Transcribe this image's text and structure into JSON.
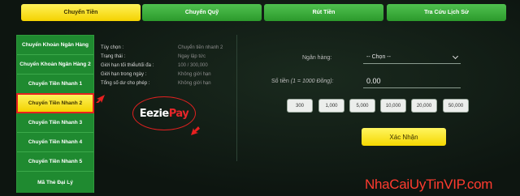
{
  "tabs": [
    {
      "label": "Chuyển Tiền",
      "active": true
    },
    {
      "label": "Chuyển Quỹ",
      "active": false
    },
    {
      "label": "Rút Tiền",
      "active": false
    },
    {
      "label": "Tra Cứu Lịch Sử",
      "active": false
    }
  ],
  "sidebar": {
    "items": [
      {
        "label": "Chuyển Khoản Ngân Hàng"
      },
      {
        "label": "Chuyển Khoản Ngân Hàng 2"
      },
      {
        "label": "Chuyển Tiền Nhanh 1"
      },
      {
        "label": "Chuyển Tiền Nhanh 2",
        "active": true
      },
      {
        "label": "Chuyển Tiền Nhanh 3"
      },
      {
        "label": "Chuyển Tiền Nhanh 4"
      },
      {
        "label": "Chuyển Tiền Nhanh 5"
      },
      {
        "label": "Mã Thẻ Đại Lý"
      }
    ]
  },
  "info": {
    "rows": [
      {
        "label": "Tùy chọn :",
        "value": "Chuyển tiền nhanh 2"
      },
      {
        "label": "Trạng thái :",
        "value": "Ngay lập tức"
      },
      {
        "label": "Giới hạn tối thiểu/tối đa :",
        "value": "100 / 300,000"
      },
      {
        "label": "Giới hạn trong ngày :",
        "value": "Không giới hạn"
      },
      {
        "label": "Tổng số dư cho phép :",
        "value": "Không giới hạn"
      }
    ]
  },
  "logo": {
    "part1": "Eezie",
    "part2": "Pay"
  },
  "form": {
    "bank_label": "Ngân hàng:",
    "bank_selected": "-- Chọn --",
    "amount_label": "Số tiền",
    "amount_hint": "(1 = 1000 Đồng):",
    "amount_value": "0.00",
    "chips": [
      "300",
      "1,000",
      "5,000",
      "10,000",
      "20,000",
      "50,000"
    ],
    "submit_label": "Xác Nhận"
  },
  "watermark": "NhaCaiUyTinVIP.com",
  "colors": {
    "accent_yellow": "#f4d200",
    "green": "#2c9a2c",
    "highlight_red": "#e82020",
    "watermark_red": "#ff3b2f"
  }
}
